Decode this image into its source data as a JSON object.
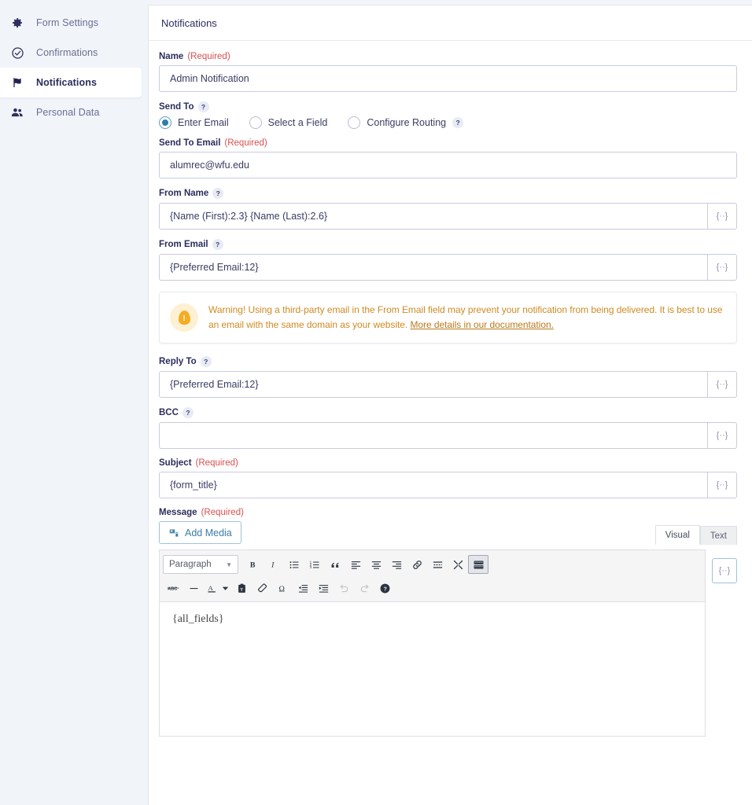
{
  "sidebar": {
    "items": [
      {
        "label": "Form Settings",
        "icon": "gear-icon",
        "active": false
      },
      {
        "label": "Confirmations",
        "icon": "check-circle-icon",
        "active": false
      },
      {
        "label": "Notifications",
        "icon": "flag-icon",
        "active": true
      },
      {
        "label": "Personal Data",
        "icon": "users-icon",
        "active": false
      }
    ]
  },
  "panel": {
    "title": "Notifications"
  },
  "fields": {
    "name": {
      "label": "Name",
      "required_text": "(Required)",
      "value": "Admin Notification"
    },
    "send_to": {
      "label": "Send To",
      "help": "?",
      "options": [
        {
          "label": "Enter Email",
          "selected": true
        },
        {
          "label": "Select a Field",
          "selected": false
        },
        {
          "label": "Configure Routing",
          "selected": false,
          "help": "?"
        }
      ]
    },
    "send_to_email": {
      "label": "Send To Email",
      "required_text": "(Required)",
      "value": "alumrec@wfu.edu"
    },
    "from_name": {
      "label": "From Name",
      "help": "?",
      "value": "{Name (First):2.3} {Name (Last):2.6}",
      "merge_tag": "{··}"
    },
    "from_email": {
      "label": "From Email",
      "help": "?",
      "value": "{Preferred Email:12}",
      "merge_tag": "{··}"
    },
    "warning": {
      "text_before": "Warning! Using a third-party email in the From Email field may prevent your notification from being delivered. It is best to use an email with the same domain as your website. ",
      "link_text": "More details in our documentation.",
      "icon": "warning-bulb-icon"
    },
    "reply_to": {
      "label": "Reply To",
      "help": "?",
      "value": "{Preferred Email:12}",
      "merge_tag": "{··}"
    },
    "bcc": {
      "label": "BCC",
      "help": "?",
      "value": "",
      "merge_tag": "{··}"
    },
    "subject": {
      "label": "Subject",
      "required_text": "(Required)",
      "value": "{form_title}",
      "merge_tag": "{··}"
    },
    "message": {
      "label": "Message",
      "required_text": "(Required)",
      "add_media_label": "Add Media",
      "tabs": [
        {
          "label": "Visual",
          "active": true
        },
        {
          "label": "Text",
          "active": false
        }
      ],
      "format_select": "Paragraph",
      "toolbar_row1": [
        "bold-icon",
        "italic-icon",
        "bulleted-list-icon",
        "numbered-list-icon",
        "blockquote-icon",
        "align-left-icon",
        "align-center-icon",
        "align-right-icon",
        "link-icon",
        "insert-more-icon",
        "fullscreen-icon",
        "toolbar-toggle-icon"
      ],
      "toolbar_row2": [
        "strikethrough-icon",
        "horizontal-rule-icon",
        "text-color-icon",
        "color-caret-icon",
        "paste-as-text-icon",
        "clear-formatting-icon",
        "special-character-icon",
        "decrease-indent-icon",
        "increase-indent-icon",
        "undo-icon",
        "redo-icon",
        "help-icon"
      ],
      "content": "{all_fields}",
      "merge_tag": "{··}"
    }
  },
  "colors": {
    "accent_blue": "#3a7ca5",
    "required_red": "#d94f4f",
    "warning_amber": "#cf8a22",
    "sidebar_bg": "#f1f4f9",
    "nav_active_text": "#2b2d5c"
  }
}
